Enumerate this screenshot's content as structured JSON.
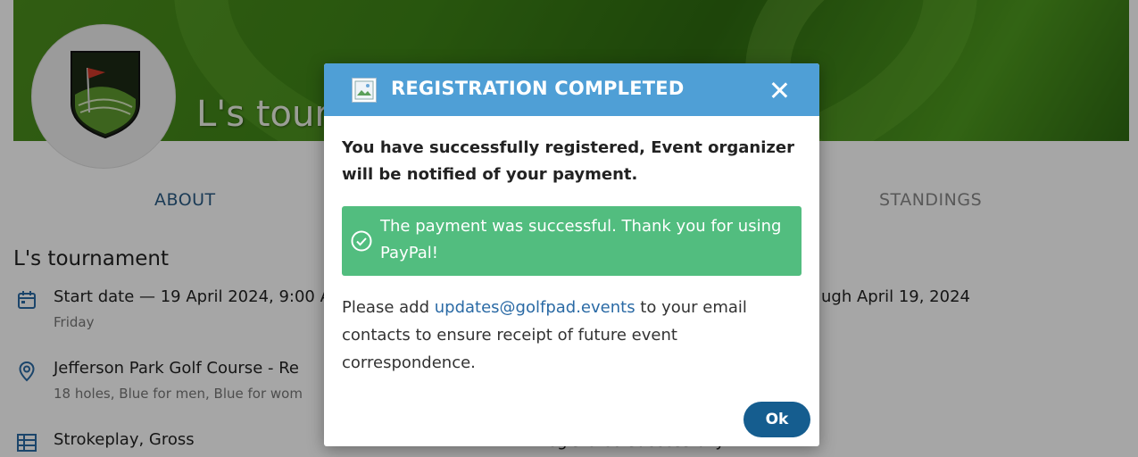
{
  "page": {
    "tournament_banner_title": "L's tourn",
    "tabs": {
      "about": "ABOUT",
      "standings": "STANDINGS"
    },
    "section_title": "L's tournament",
    "start_date": {
      "main": "Start date — 19 April 2024, 9:00 A",
      "sub": "Friday"
    },
    "course": {
      "main": "Jefferson Park Golf Course - Re",
      "sub": "18 holes, Blue for men, Blue for wom"
    },
    "format": {
      "main": "Strokeplay, Gross"
    },
    "right_date_text": "ugh April 19, 2024",
    "right_bottom_text": "…egistered successfully."
  },
  "modal": {
    "title": "REGISTRATION COMPLETED",
    "message": "You have successfully registered, Event organizer will be notified of your payment.",
    "alert_text": "The payment was successful. Thank you for using PayPal!",
    "note_before": "Please add ",
    "note_link": "updates@golfpad.events",
    "note_after": " to your email contacts to ensure receipt of future event correspondence.",
    "ok_label": "Ok"
  },
  "colors": {
    "header": "#4f9fd6",
    "alert_success": "#52bd7f",
    "ok_button": "#155d8f",
    "link": "#2a6aa5"
  },
  "icons": {
    "close": "close-icon",
    "broken_image": "broken-image-icon",
    "check": "check-circle-icon",
    "calendar": "calendar-icon",
    "location": "location-pin-icon",
    "table": "table-icon"
  }
}
